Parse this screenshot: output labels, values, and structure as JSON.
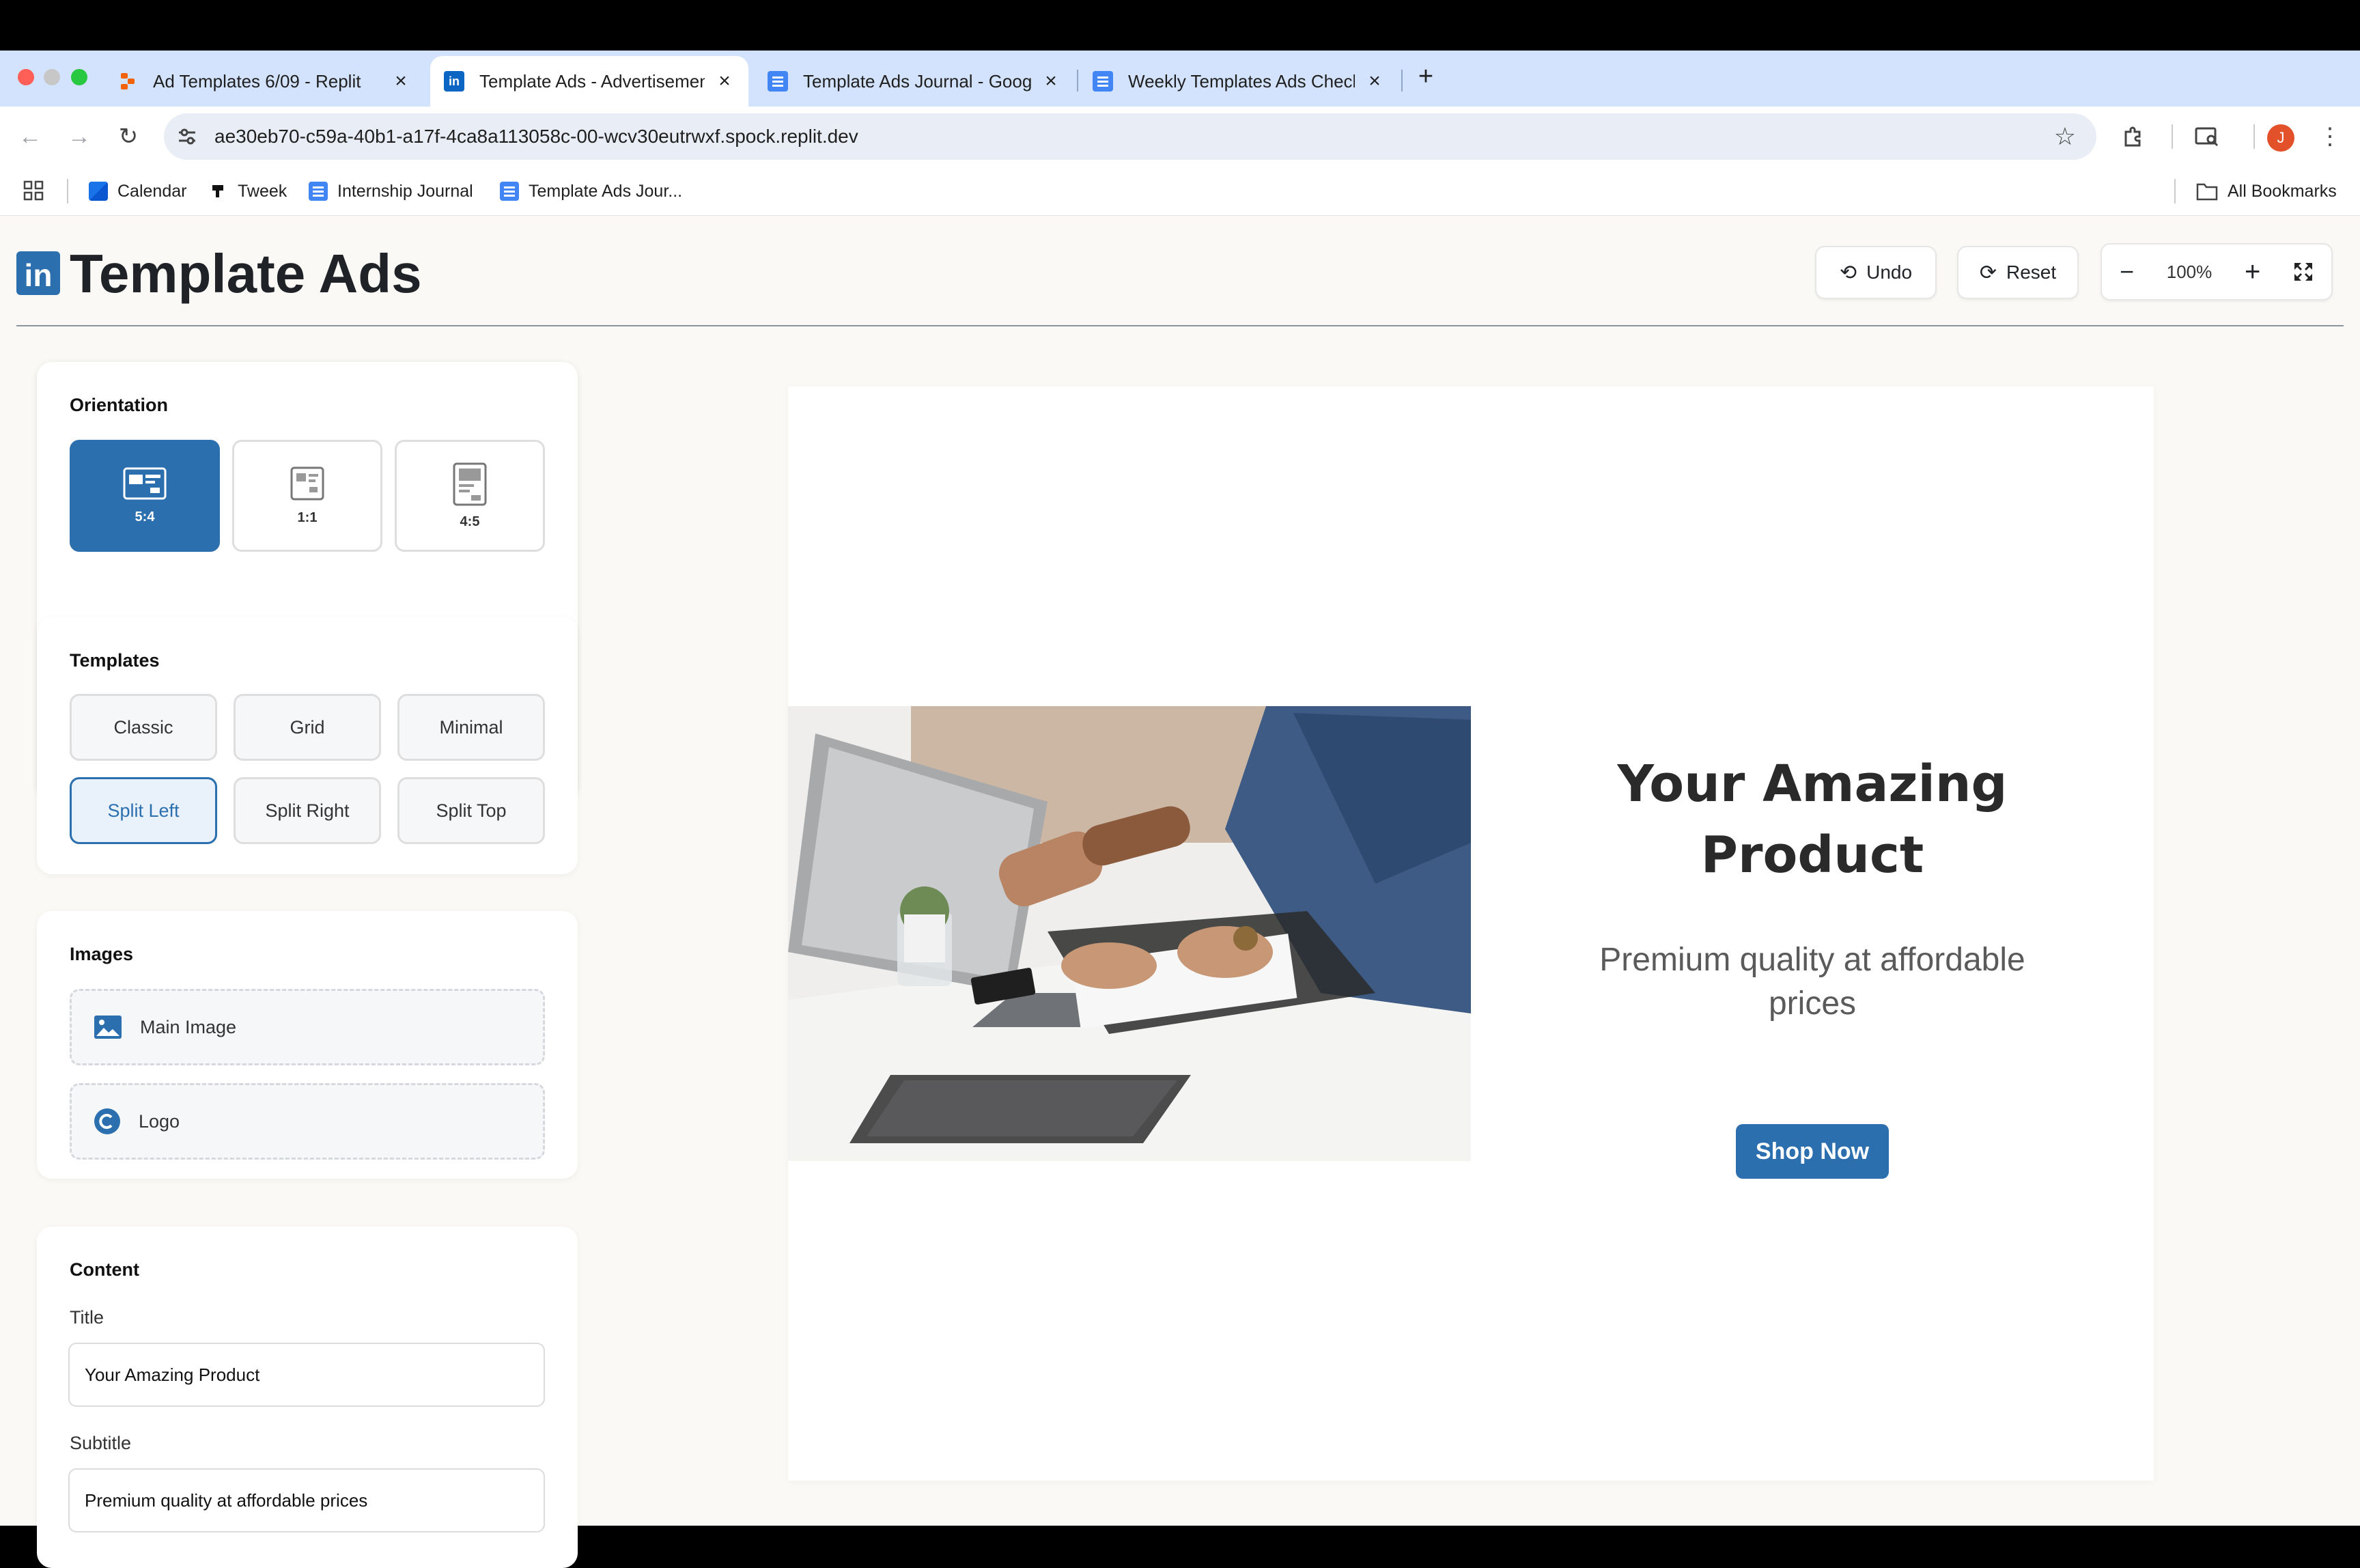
{
  "browser": {
    "tabs": [
      {
        "title": "Ad Templates 6/09 - Replit",
        "close": "×",
        "active": false,
        "icon": "replit-icon"
      },
      {
        "title": "Template Ads - Advertisement",
        "close": "×",
        "active": true,
        "icon": "linkedin-icon"
      },
      {
        "title": "Template Ads Journal - Google Docs",
        "close": "×",
        "active": false,
        "icon": "google-docs-icon"
      },
      {
        "title": "Weekly Templates Ads Check-in",
        "close": "×",
        "active": false,
        "icon": "google-docs-icon"
      }
    ],
    "new_tab": "+",
    "url": "ae30eb70-c59a-40b1-a17f-4ca8a113058c-00-wcv30eutrwxf.spock.replit.dev",
    "profile_initial": "J",
    "bookmarks": [
      {
        "label": "Calendar",
        "icon": "calendar-icon"
      },
      {
        "label": "Tweek",
        "icon": "tweek-icon"
      },
      {
        "label": "Internship Journal",
        "icon": "google-docs-icon"
      },
      {
        "label": "Template Ads Jour...",
        "icon": "google-docs-icon"
      }
    ],
    "all_bookmarks": "All Bookmarks"
  },
  "app": {
    "logo_text": "in",
    "title": "Template Ads",
    "undo_label": "Undo",
    "reset_label": "Reset",
    "zoom_minus": "−",
    "zoom_level": "100%",
    "zoom_plus": "+"
  },
  "sidebar": {
    "orientation": {
      "heading": "Orientation",
      "options": [
        {
          "label": "5:4",
          "selected": true
        },
        {
          "label": "1:1",
          "selected": false
        },
        {
          "label": "4:5",
          "selected": false
        }
      ]
    },
    "templates": {
      "heading": "Templates",
      "options": [
        {
          "label": "Classic",
          "selected": false
        },
        {
          "label": "Grid",
          "selected": false
        },
        {
          "label": "Minimal",
          "selected": false
        },
        {
          "label": "Split Left",
          "selected": true
        },
        {
          "label": "Split Right",
          "selected": false
        },
        {
          "label": "Split Top",
          "selected": false
        }
      ]
    },
    "images": {
      "heading": "Images",
      "main_image": "Main Image",
      "logo": "Logo"
    },
    "content": {
      "heading": "Content",
      "title_label": "Title",
      "title_value": "Your Amazing Product",
      "subtitle_label": "Subtitle",
      "subtitle_value": "Premium quality at affordable prices"
    }
  },
  "preview": {
    "title_line1": "Your Amazing",
    "title_line2": "Product",
    "subtitle_line1": "Premium quality at affordable",
    "subtitle_line2": "prices",
    "cta": "Shop Now"
  },
  "colors": {
    "accent": "#2c6faf",
    "tabstrip": "#d3e3fd",
    "app_background": "#fbf9f5",
    "profile": "#e2512a"
  }
}
